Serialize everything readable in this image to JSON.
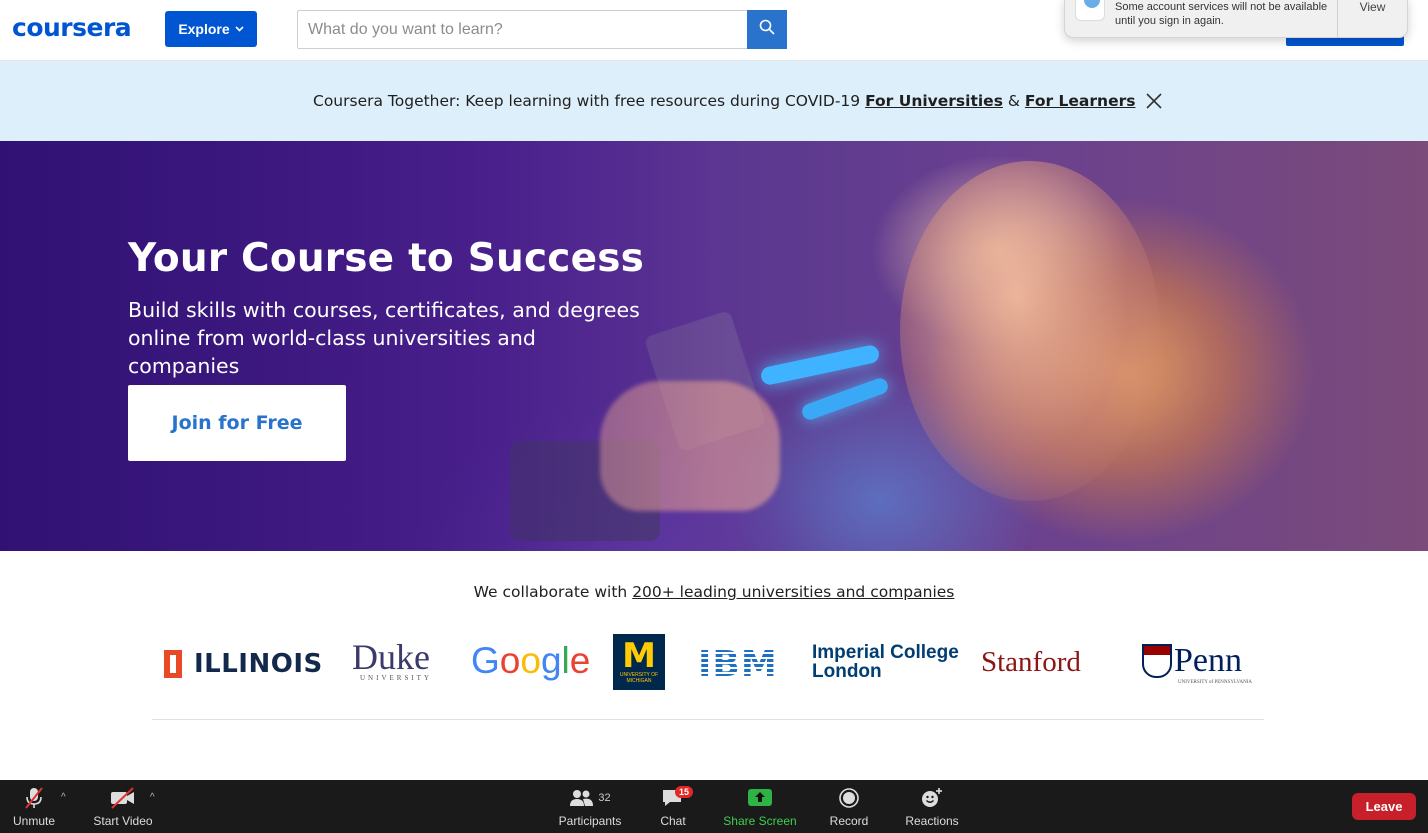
{
  "header": {
    "logo": "coursera",
    "explore_label": "Explore",
    "search_placeholder": "What do you want to learn?"
  },
  "notification": {
    "text": "Some account services will not be available until you sign in again.",
    "view_label": "View"
  },
  "banner": {
    "text": "Coursera Together: Keep learning with free resources during COVID-19",
    "link_universities": "For Universities",
    "amp": "&",
    "link_learners": "For Learners"
  },
  "hero": {
    "title": "Your Course to Success",
    "subtitle": "Build skills with courses, certificates, and degrees online from world-class universities and companies",
    "join_label": "Join for Free"
  },
  "collab": {
    "prefix": "We collaborate with",
    "link": "200+ leading universities and companies"
  },
  "partners": {
    "illinois": "ILLINOIS",
    "duke": "Duke",
    "duke_sub": "UNIVERSITY",
    "google": [
      "G",
      "o",
      "o",
      "g",
      "l",
      "e"
    ],
    "google_colors": [
      "#4285F4",
      "#EA4335",
      "#FBBC05",
      "#4285F4",
      "#34A853",
      "#EA4335"
    ],
    "michigan": "M",
    "michigan_sub": "UNIVERSITY OF MICHIGAN",
    "ibm": "IBM",
    "imperial_line1": "Imperial College",
    "imperial_line2": "London",
    "stanford": "Stanford",
    "penn": "Penn",
    "penn_sub": "UNIVERSITY of PENNSYLVANIA"
  },
  "zoom": {
    "unmute": "Unmute",
    "start_video": "Start Video",
    "participants": "Participants",
    "participant_count": "32",
    "chat": "Chat",
    "chat_badge": "15",
    "share_screen": "Share Screen",
    "record": "Record",
    "reactions": "Reactions",
    "leave": "Leave"
  },
  "colors": {
    "brand_blue": "#0056d2",
    "banner_bg": "#ddeffa",
    "share_green": "#3ecf4e",
    "leave_red": "#c8202b"
  }
}
